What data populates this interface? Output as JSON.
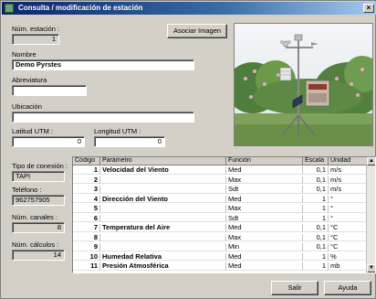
{
  "window": {
    "title": "Consulta / modificación de estación",
    "close_label": "×"
  },
  "form": {
    "num_estacion_label": "Núm. estación :",
    "num_estacion_value": "1",
    "nombre_label": "Nombre",
    "nombre_value": "Demo Pyrstes",
    "abreviatura_label": "Abreviatura",
    "abreviatura_value": "",
    "ubicacion_label": "Ubicación",
    "ubicacion_value": "",
    "latitud_label": "Latitud UTM :",
    "latitud_value": "0",
    "longitud_label": "Longitud UTM :",
    "longitud_value": "0",
    "tipo_conexion_label": "Tipo de conexión :",
    "tipo_conexion_value": "TAPI",
    "telefono_label": "Teléfono :",
    "telefono_value": "962757905",
    "num_canales_label": "Núm. canales :",
    "num_canales_value": "8",
    "num_calculos_label": "Núm. cálculos :",
    "num_calculos_value": "14"
  },
  "buttons": {
    "asociar_imagen": "Asociar Imagen",
    "salir": "Salir",
    "ayuda": "Ayuda"
  },
  "grid": {
    "headers": {
      "code": "Código",
      "param": "Parámetro",
      "func": "Función",
      "scale": "Escala",
      "unit": "Unidad"
    },
    "rows": [
      {
        "code": "1",
        "param": "Velocidad del Viento",
        "func": "Med",
        "scale": "0,1",
        "unit": "m/s"
      },
      {
        "code": "2",
        "param": "",
        "func": "Max",
        "scale": "0,1",
        "unit": "m/s"
      },
      {
        "code": "3",
        "param": "",
        "func": "Sdt",
        "scale": "0,1",
        "unit": "m/s"
      },
      {
        "code": "4",
        "param": "Dirección del Viento",
        "func": "Med",
        "scale": "1",
        "unit": "°"
      },
      {
        "code": "5",
        "param": "",
        "func": "Max",
        "scale": "1",
        "unit": "°"
      },
      {
        "code": "6",
        "param": "",
        "func": "Sdt",
        "scale": "1",
        "unit": "°"
      },
      {
        "code": "7",
        "param": "Temperatura del Aire",
        "func": "Med",
        "scale": "0,1",
        "unit": "°C"
      },
      {
        "code": "8",
        "param": "",
        "func": "Max",
        "scale": "0,1",
        "unit": "°C"
      },
      {
        "code": "9",
        "param": "",
        "func": "Min",
        "scale": "0,1",
        "unit": "°C"
      },
      {
        "code": "10",
        "param": "Humedad Relativa",
        "func": "Med",
        "scale": "1",
        "unit": "%"
      },
      {
        "code": "11",
        "param": "Presión Atmosférica",
        "func": "Med",
        "scale": "1",
        "unit": "mb"
      }
    ]
  }
}
